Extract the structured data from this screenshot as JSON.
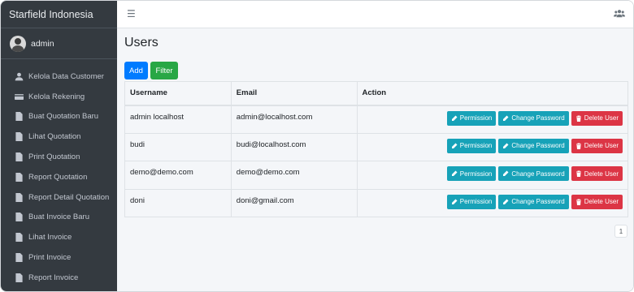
{
  "sidebar": {
    "brand": "Starfield Indonesia",
    "user": {
      "name": "admin"
    },
    "items": [
      {
        "label": "Kelola Data Customer",
        "icon": "user-icon"
      },
      {
        "label": "Kelola Rekening",
        "icon": "credit-card-icon"
      },
      {
        "label": "Buat Quotation Baru",
        "icon": "file-icon"
      },
      {
        "label": "Lihat Quotation",
        "icon": "file-icon"
      },
      {
        "label": "Print Quotation",
        "icon": "file-icon"
      },
      {
        "label": "Report Quotation",
        "icon": "file-icon"
      },
      {
        "label": "Report Detail Quotation",
        "icon": "file-icon"
      },
      {
        "label": "Buat Invoice Baru",
        "icon": "file-icon"
      },
      {
        "label": "Lihat Invoice",
        "icon": "file-icon"
      },
      {
        "label": "Print Invoice",
        "icon": "file-icon"
      },
      {
        "label": "Report Invoice",
        "icon": "file-icon"
      }
    ]
  },
  "topbar": {
    "menu_icon": "hamburger-icon",
    "users_icon": "users-icon"
  },
  "main": {
    "title": "Users",
    "add_label": "Add",
    "filter_label": "Filter",
    "table": {
      "columns": [
        "Username",
        "Email",
        "Action"
      ],
      "rows": [
        {
          "username": "admin localhost",
          "email": "admin@localhost.com"
        },
        {
          "username": "budi",
          "email": "budi@localhost.com"
        },
        {
          "username": "demo@demo.com",
          "email": "demo@demo.com"
        },
        {
          "username": "doni",
          "email": "doni@gmail.com"
        }
      ],
      "actions": {
        "permission": "Permission",
        "change_password": "Change Password",
        "delete_user": "Delete User"
      }
    },
    "pagination": {
      "current_page": "1"
    }
  },
  "colors": {
    "sidebar_bg": "#343a40",
    "primary": "#007bff",
    "success": "#28a745",
    "info": "#17a2b8",
    "danger": "#dc3545"
  }
}
